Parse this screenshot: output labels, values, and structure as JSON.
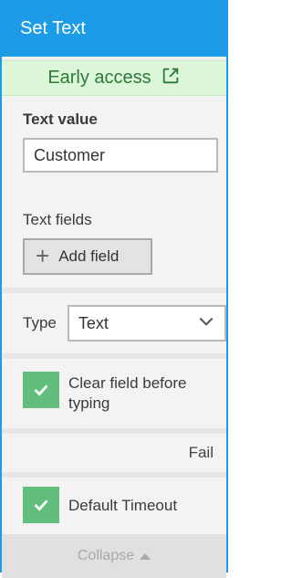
{
  "header": {
    "title": "Set Text"
  },
  "banner": {
    "label": "Early access",
    "icon": "external-link-icon"
  },
  "text_value": {
    "label": "Text value",
    "value": "Customer"
  },
  "text_fields": {
    "label": "Text fields",
    "add_button": "Add field"
  },
  "type": {
    "label": "Type",
    "selected": "Text"
  },
  "clear_field": {
    "label": "Clear field before typing",
    "checked": true
  },
  "fail": {
    "label": "Fail"
  },
  "default_timeout": {
    "label": "Default Timeout",
    "checked": true
  },
  "footer": {
    "collapse_label": "Collapse"
  },
  "colors": {
    "header": "#1d9be6",
    "banner_bg": "#dbf6d9",
    "checkbox": "#62be7d"
  }
}
